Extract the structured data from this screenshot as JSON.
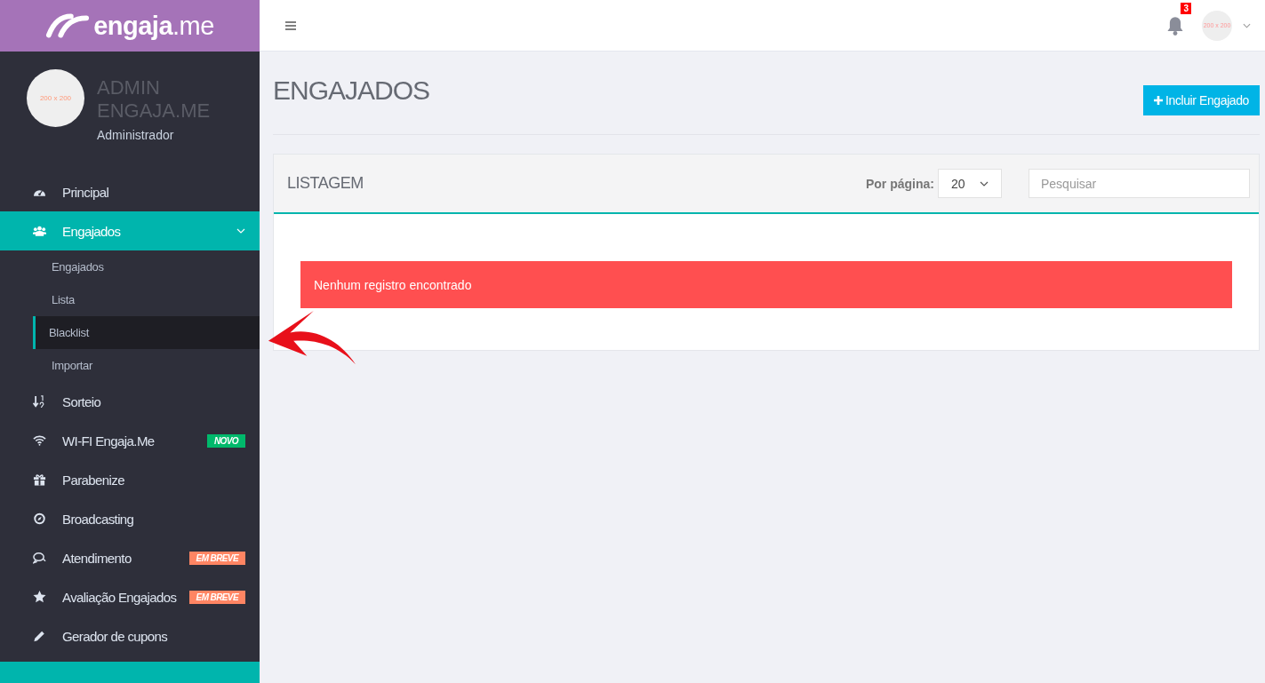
{
  "logo": {
    "bold": "engaja",
    "light": ".me"
  },
  "profile": {
    "avatar": "200 x 200",
    "name": "ADMIN ENGAJA.ME",
    "role": "Administrador"
  },
  "menu": [
    {
      "label": "Principal",
      "selected": false
    },
    {
      "label": "Engajados",
      "selected": true,
      "expanded": true,
      "children": [
        {
          "label": "Engajados",
          "selected": false
        },
        {
          "label": "Lista",
          "selected": false
        },
        {
          "label": "Blacklist",
          "selected": true
        },
        {
          "label": "Importar",
          "selected": false
        }
      ]
    },
    {
      "label": "Sorteio",
      "selected": false
    },
    {
      "label": "WI-FI Engaja.Me",
      "selected": false,
      "badge": {
        "text": "NOVO",
        "color": "#00b96b"
      }
    },
    {
      "label": "Parabenize",
      "selected": false
    },
    {
      "label": "Broadcasting",
      "selected": false
    },
    {
      "label": "Atendimento",
      "selected": false,
      "badge": {
        "text": "EM BREVE",
        "color": "#ff8563"
      }
    },
    {
      "label": "Avaliação Engajados",
      "selected": false,
      "badge": {
        "text": "EM BREVE",
        "color": "#ff8563"
      }
    },
    {
      "label": "Gerador de cupons",
      "selected": false
    }
  ],
  "header": {
    "notifications": "3",
    "avatar": "200 x 200"
  },
  "page": {
    "title": "ENGAJADOS",
    "add_button": "Incluir Engajado"
  },
  "panel": {
    "title": "LISTAGEM",
    "per_page_label": "Por página:",
    "per_page": "20",
    "search": {
      "placeholder": "Pesquisar"
    },
    "alert": "Nenhum registro encontrado"
  }
}
